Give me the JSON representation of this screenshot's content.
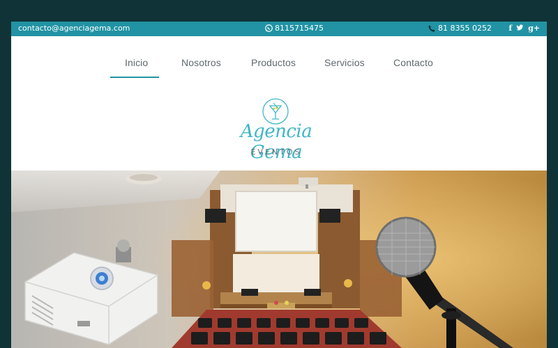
{
  "topbar": {
    "email": "contacto@agenciagema.com",
    "whatsapp": "8115715475",
    "phone": "81 8355 0252",
    "social": {
      "facebook": "f",
      "twitter": "t",
      "googleplus": "g+"
    }
  },
  "nav": {
    "items": [
      {
        "label": "Inicio",
        "active": true
      },
      {
        "label": "Nosotros"
      },
      {
        "label": "Productos"
      },
      {
        "label": "Servicios"
      },
      {
        "label": "Contacto"
      }
    ]
  },
  "logo": {
    "name": "Agencia Gema",
    "subtitle": "EVENTOS"
  },
  "colors": {
    "accent": "#2193a4",
    "frame": "#0f3337",
    "logo": "#3fb6c6"
  }
}
